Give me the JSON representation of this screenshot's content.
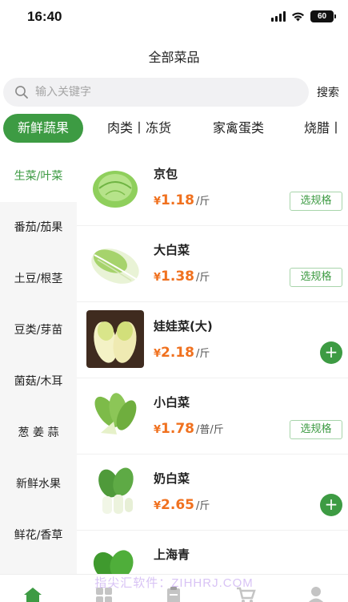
{
  "status_bar": {
    "time": "16:40",
    "battery": "60"
  },
  "header": {
    "title": "全部菜品"
  },
  "search": {
    "placeholder": "输入关键字",
    "value": "",
    "button_label": "搜索"
  },
  "category_tabs": [
    {
      "label": "新鲜蔬果",
      "active": true
    },
    {
      "label": "肉类丨冻货",
      "active": false
    },
    {
      "label": "家禽蛋类",
      "active": false
    },
    {
      "label": "烧腊丨",
      "active": false
    }
  ],
  "sidebar": {
    "items": [
      {
        "label": "生菜/叶菜",
        "active": true
      },
      {
        "label": "番茄/茄果",
        "active": false
      },
      {
        "label": "土豆/根茎",
        "active": false
      },
      {
        "label": "豆类/芽苗",
        "active": false
      },
      {
        "label": "菌菇/木耳",
        "active": false
      },
      {
        "label": "葱 姜 蒜",
        "active": false
      },
      {
        "label": "新鲜水果",
        "active": false
      },
      {
        "label": "鲜花/香草",
        "active": false
      }
    ]
  },
  "products": [
    {
      "name": "京包",
      "currency": "¥",
      "price": "1.18",
      "unit": "/斤",
      "action": "选规格",
      "action_type": "spec",
      "image": "cabbage"
    },
    {
      "name": "大白菜",
      "currency": "¥",
      "price": "1.38",
      "unit": "/斤",
      "action": "选规格",
      "action_type": "spec",
      "image": "napa-cabbage"
    },
    {
      "name": "娃娃菜(大)",
      "currency": "¥",
      "price": "2.18",
      "unit": "/斤",
      "action": "+",
      "action_type": "add",
      "image": "baby-cabbage"
    },
    {
      "name": "小白菜",
      "currency": "¥",
      "price": "1.78",
      "unit": "/普/斤",
      "action": "选规格",
      "action_type": "spec",
      "image": "bok-choy"
    },
    {
      "name": "奶白菜",
      "currency": "¥",
      "price": "2.65",
      "unit": "/斤",
      "action": "+",
      "action_type": "add",
      "image": "milk-bok-choy"
    },
    {
      "name": "上海青",
      "currency": "",
      "price": "",
      "unit": "",
      "action": "",
      "action_type": "none",
      "image": "shanghai-greens"
    }
  ],
  "watermark": "指尖汇软件：ZIHHRJ.COM",
  "tabbar": {
    "items": [
      {
        "icon": "home-icon",
        "active": true
      },
      {
        "icon": "category-icon",
        "active": false
      },
      {
        "icon": "orders-icon",
        "active": false
      },
      {
        "icon": "cart-icon",
        "active": false
      },
      {
        "icon": "profile-icon",
        "active": false
      }
    ]
  },
  "colors": {
    "accent": "#3d9b43",
    "price": "#f0711f",
    "sidebar_bg": "#f6f6f6"
  }
}
